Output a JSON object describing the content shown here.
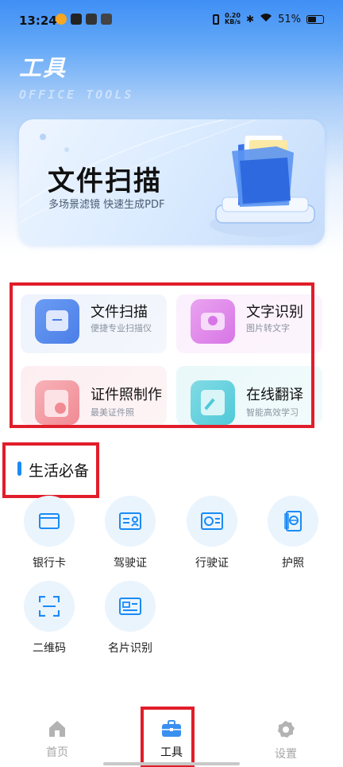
{
  "status_bar": {
    "time": "13:24",
    "net_speed_value": "0.20",
    "net_speed_unit": "KB/s",
    "battery_text": "51%",
    "battery_level": 0.51
  },
  "header": {
    "title": "工具",
    "subtitle": "OFFICE TOOLS"
  },
  "banner": {
    "title": "文件扫描",
    "description": "多场景滤镜  快速生成PDF"
  },
  "features": [
    {
      "title": "文件扫描",
      "subtitle": "便捷专业扫描仪",
      "icon": "scan-doc-icon",
      "color": "#5b8ff0"
    },
    {
      "title": "文字识别",
      "subtitle": "图片转文字",
      "icon": "camera-icon",
      "color": "#d775e6"
    },
    {
      "title": "证件照制作",
      "subtitle": "最美证件照",
      "icon": "id-photo-icon",
      "color": "#f18a93"
    },
    {
      "title": "在线翻译",
      "subtitle": "智能高效学习",
      "icon": "edit-translate-icon",
      "color": "#4fc9d8"
    }
  ],
  "section": {
    "title": "生活必备"
  },
  "tools": [
    {
      "label": "银行卡",
      "icon": "bank-card-icon"
    },
    {
      "label": "驾驶证",
      "icon": "driver-license-icon"
    },
    {
      "label": "行驶证",
      "icon": "vehicle-license-icon"
    },
    {
      "label": "护照",
      "icon": "passport-icon"
    },
    {
      "label": "二维码",
      "icon": "qr-scan-icon"
    },
    {
      "label": "名片识别",
      "icon": "business-card-icon"
    }
  ],
  "bottom_nav": [
    {
      "label": "首页",
      "icon": "home-icon",
      "active": false
    },
    {
      "label": "工具",
      "icon": "toolbox-icon",
      "active": true
    },
    {
      "label": "设置",
      "icon": "gear-icon",
      "active": false
    }
  ],
  "colors": {
    "accent": "#1a8bf5",
    "highlight": "#e11d2a",
    "inactive": "#a6a6a6"
  }
}
